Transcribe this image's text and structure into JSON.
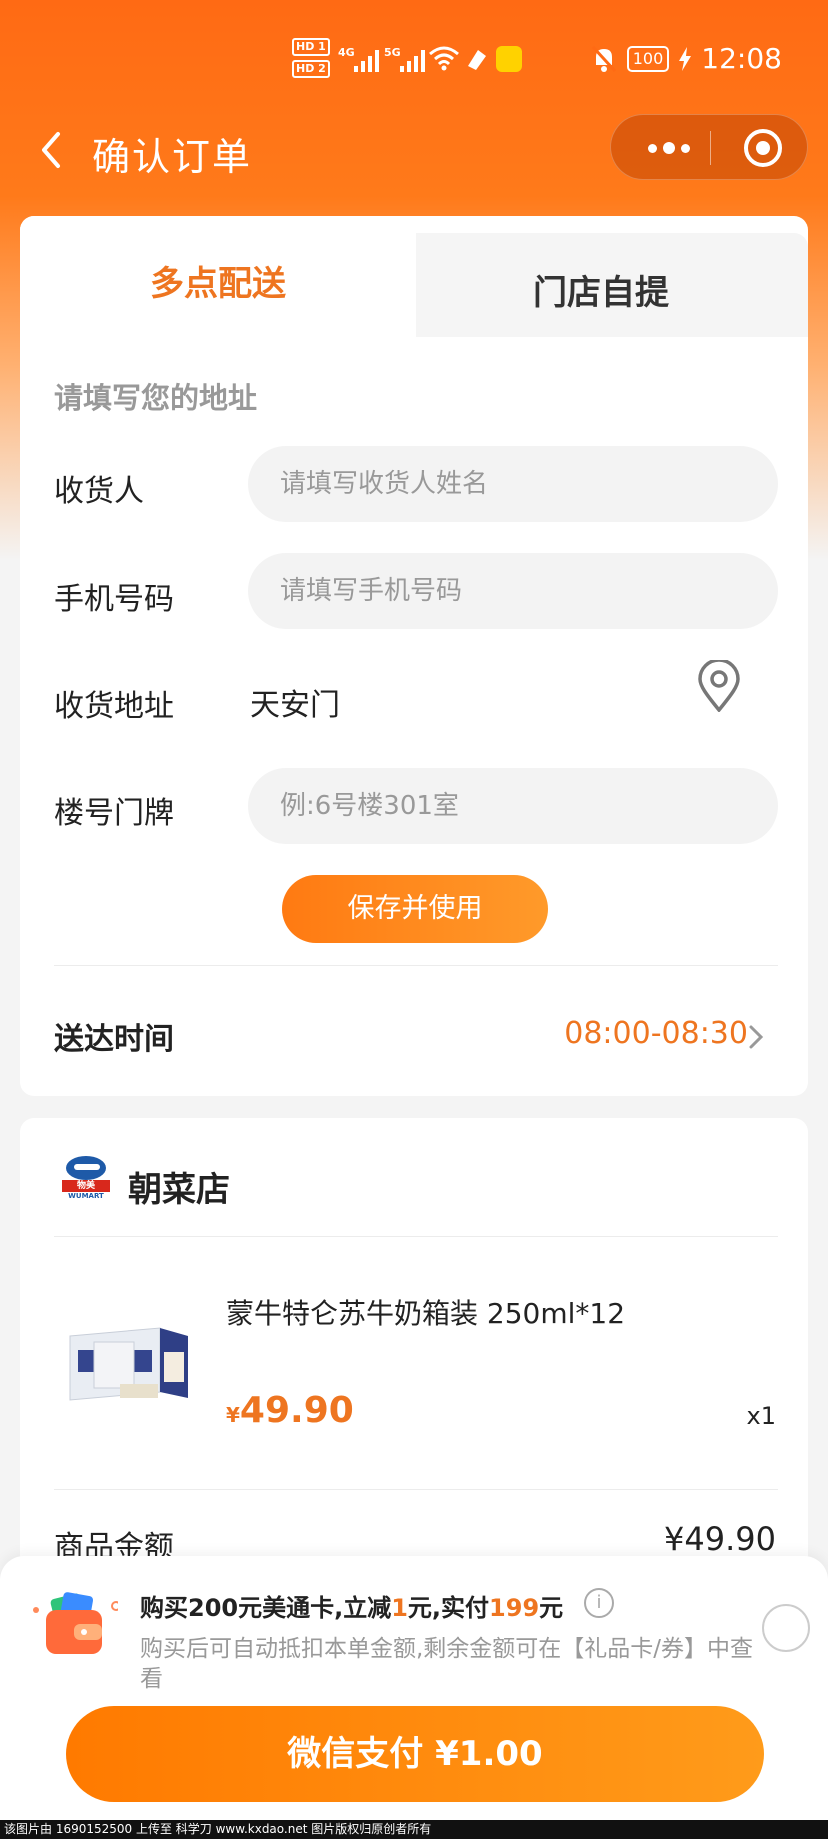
{
  "status_bar": {
    "hd1": "HD 1",
    "hd2": "HD 2",
    "sig1": "4G",
    "sig2": "5G",
    "battery": "100",
    "time": "12:08"
  },
  "nav": {
    "title": "确认订单"
  },
  "tabs": [
    {
      "label": "多点配送",
      "active": true
    },
    {
      "label": "门店自提",
      "active": false
    }
  ],
  "address_form": {
    "hint": "请填写您的地址",
    "receiver_label": "收货人",
    "receiver_placeholder": "请填写收货人姓名",
    "phone_label": "手机号码",
    "phone_placeholder": "请填写手机号码",
    "address_label": "收货地址",
    "address_value": "天安门",
    "building_label": "楼号门牌",
    "building_placeholder": "例:6号楼301室",
    "save_button": "保存并使用"
  },
  "delivery": {
    "label": "送达时间",
    "time": "08:00-08:30"
  },
  "store": {
    "logo_cn": "物美",
    "logo_en": "WUMART",
    "name": "朝菜店",
    "product": {
      "name": "蒙牛特仑苏牛奶箱装 250ml*12",
      "currency": "¥",
      "price": "49.90",
      "quantity": "x1"
    },
    "subtotal_label": "商品金额",
    "subtotal_value": "¥49.90"
  },
  "promo": {
    "title_1": "购买",
    "title_2": "200元美通卡,立减",
    "title_hl1": "1",
    "title_3": "元,实付",
    "title_hl2": "199",
    "title_4": "元",
    "description": "购买后可自动抵扣本单金额,剩余金额可在【礼品卡/券】中查看"
  },
  "pay_button": "微信支付 ¥1.00",
  "footer": "该图片由 1690152500 上传至 科学刀 www.kxdao.net 图片版权归原创者所有",
  "colors": {
    "brand_orange": "#ff6a14",
    "accent_text": "#ee7520"
  },
  "icons": [
    "back-icon",
    "more-icon",
    "target-icon",
    "location-pin-icon",
    "chevron-right-icon",
    "wallet-icon",
    "info-icon"
  ]
}
